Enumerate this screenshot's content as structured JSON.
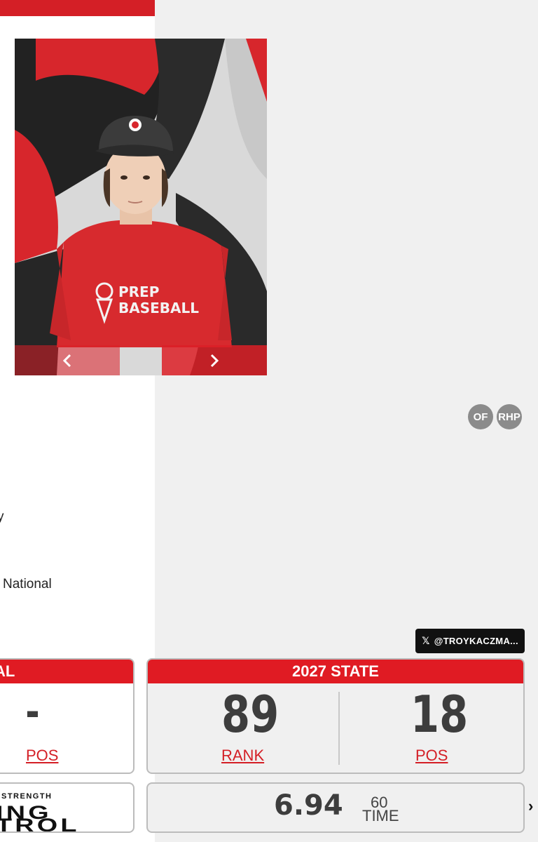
{
  "colors": {
    "brand_red": "#e01b23",
    "chip_gray": "#8b8b8b"
  },
  "carousel": {
    "prev_icon": "chevron-left-icon",
    "next_icon": "chevron-right-icon",
    "shirt_text_1": "PREP",
    "shirt_text_2": "BASEBALL"
  },
  "positions": [
    "OF",
    "RHP"
  ],
  "info": {
    "partial_line": "y",
    "national_line": "National"
  },
  "twitter": {
    "handle": "@TROYKACZMA..."
  },
  "rankings": {
    "national": {
      "title": "AL",
      "pos_value": "-",
      "pos_label": "POS"
    },
    "state": {
      "title": "2027 STATE",
      "rank_value": "89",
      "rank_label": "RANK",
      "pos_value": "18",
      "pos_label": "POS"
    }
  },
  "strength": {
    "line1": "STRENGTH",
    "line2": "ING",
    "line3": "TROL"
  },
  "time": {
    "value": "6.94",
    "label_top": "60",
    "label_bottom": "TIME"
  }
}
